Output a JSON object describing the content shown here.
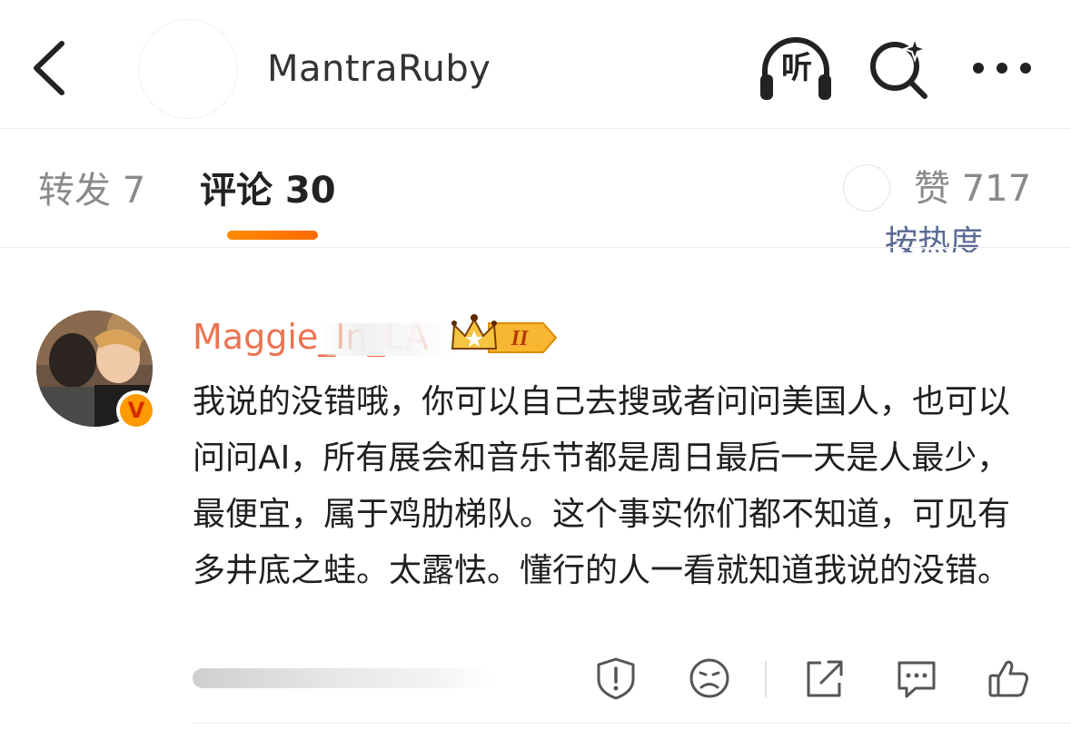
{
  "header": {
    "title": "MantraRuby",
    "listen_label": "听",
    "icons": {
      "back": "chevron-left-icon",
      "listen": "headphones-icon",
      "search": "search-sparkle-icon",
      "more": "more-dots-icon"
    }
  },
  "tabs": {
    "repost": {
      "label": "转发 7"
    },
    "comment": {
      "label": "评论 30"
    },
    "like": {
      "label": "赞 717"
    },
    "sort_fragment": "按热度"
  },
  "comment": {
    "username": "Maggie_In_LA",
    "badge": {
      "label": "II"
    },
    "verified_mark": "V",
    "text": "我说的没错哦，你可以自己去搜或者问问美国人，也可以问问AI，所有展会和音乐节都是周日最后一天是人最少，最便宜，属于鸡肋梯队。这个事实你们都不知道，可见有多井底之蛙。太露怯。懂行的人一看就知道我说的没错。",
    "actions": [
      "report-icon",
      "dislike-face-icon",
      "share-icon",
      "reply-bubble-icon",
      "thumbs-up-icon"
    ]
  },
  "colors": {
    "accent_orange": "#ff8200",
    "username": "#eb7350",
    "muted_text": "#8a8a8a",
    "sort_link": "#5a6b94"
  }
}
